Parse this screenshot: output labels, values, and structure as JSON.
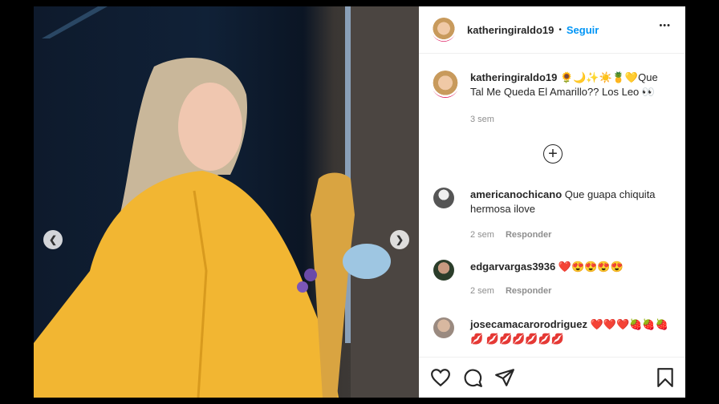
{
  "post": {
    "username": "katheringiraldo19",
    "follow_label": "Seguir",
    "more_label": "•••",
    "separator": "•",
    "caption_text": "🌻🌙✨☀️🍍💛Que Tal Me Queda El Amarillo?? Los Leo 👀",
    "caption_time": "3 sem",
    "load_more_label": "+"
  },
  "comments": [
    {
      "user": "americanochicano",
      "text": "Que guapa chiquita hermosa ilove",
      "time": "2 sem",
      "reply": "Responder"
    },
    {
      "user": "edgarvargas3936",
      "text": "❤️😍😍😍😍",
      "time": "2 sem",
      "reply": "Responder"
    },
    {
      "user": "josecamacarorodriguez",
      "text": "❤️❤️❤️🍓🍓🍓💋 💋💋💋💋💋💋",
      "time": "",
      "reply": ""
    }
  ],
  "colors": {
    "accent": "#0095f6",
    "text": "#262626",
    "muted": "#8e8e8e",
    "heart": "#ed4956"
  },
  "icons": [
    "chevron-left-icon",
    "chevron-right-icon",
    "more-icon",
    "plus-circle-icon",
    "heart-icon",
    "comment-icon",
    "share-icon",
    "bookmark-icon"
  ]
}
